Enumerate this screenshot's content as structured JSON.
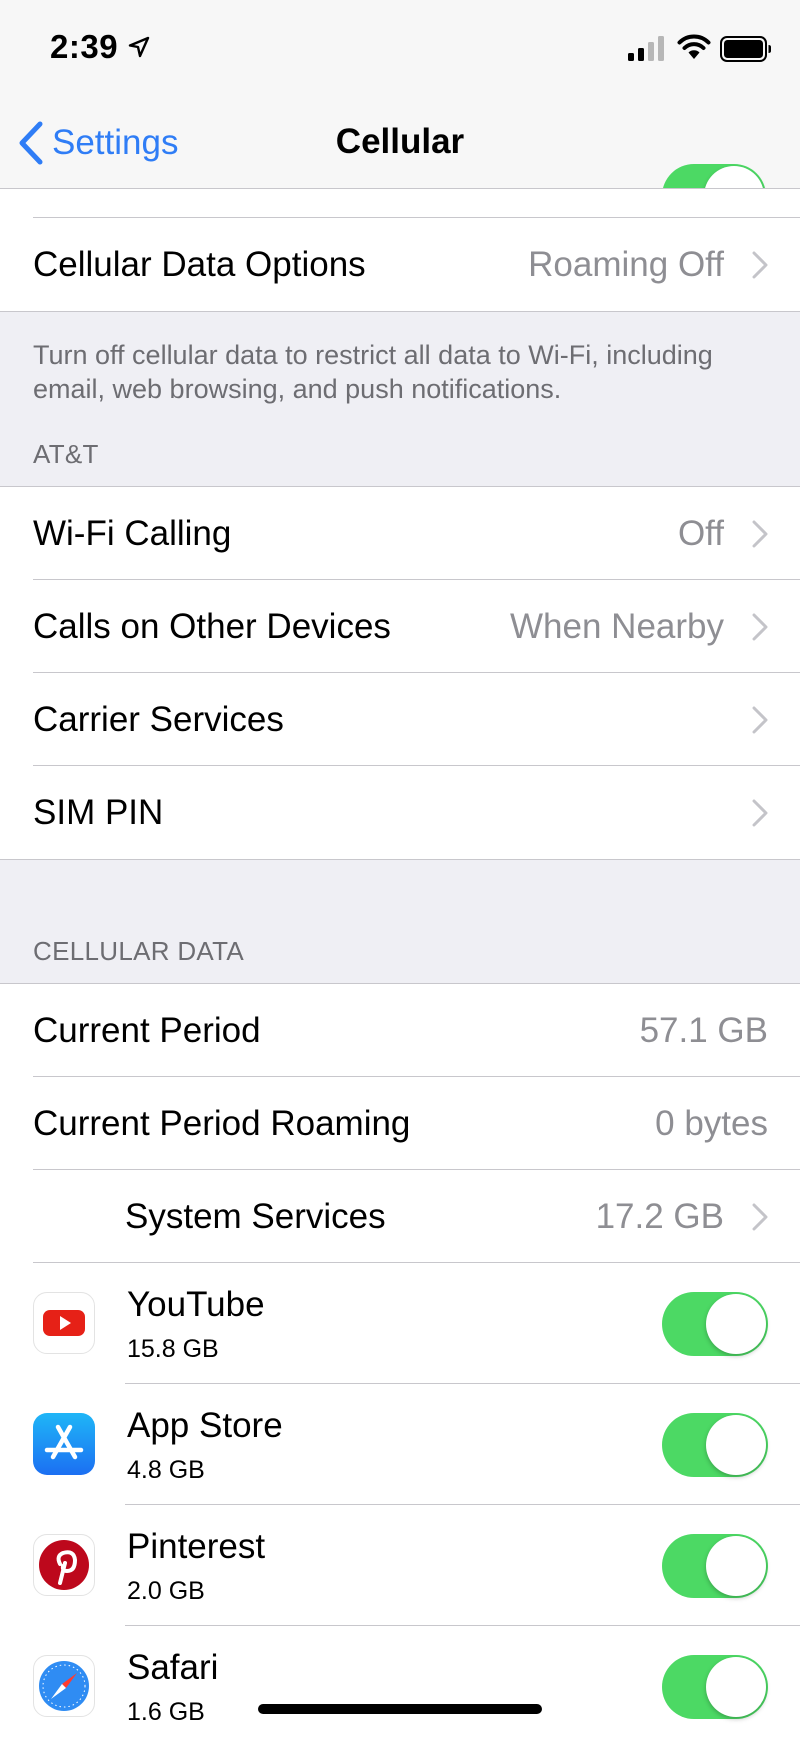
{
  "status_bar": {
    "time": "2:39"
  },
  "nav": {
    "back_label": "Settings",
    "title": "Cellular"
  },
  "top_group": {
    "cellular_data_options": {
      "label": "Cellular Data Options",
      "value": "Roaming Off"
    }
  },
  "cellular_note": "Turn off cellular data to restrict all data to Wi-Fi, including email, web browsing, and push notifications.",
  "carrier_section": {
    "header": "AT&T",
    "items": [
      {
        "label": "Wi-Fi Calling",
        "value": "Off"
      },
      {
        "label": "Calls on Other Devices",
        "value": "When Nearby"
      },
      {
        "label": "Carrier Services",
        "value": ""
      },
      {
        "label": "SIM PIN",
        "value": ""
      }
    ]
  },
  "data_section": {
    "header": "CELLULAR DATA",
    "current_period": {
      "label": "Current Period",
      "value": "57.1 GB"
    },
    "current_period_roaming": {
      "label": "Current Period Roaming",
      "value": "0 bytes"
    },
    "system_services": {
      "label": "System Services",
      "value": "17.2 GB"
    },
    "apps": [
      {
        "name": "YouTube",
        "usage": "15.8 GB",
        "enabled": true,
        "icon": "youtube-icon"
      },
      {
        "name": "App Store",
        "usage": "4.8 GB",
        "enabled": true,
        "icon": "app-store-icon"
      },
      {
        "name": "Pinterest",
        "usage": "2.0 GB",
        "enabled": true,
        "icon": "pinterest-icon"
      },
      {
        "name": "Safari",
        "usage": "1.6 GB",
        "enabled": true,
        "icon": "safari-icon"
      }
    ]
  },
  "colors": {
    "accent": "#2f7df6",
    "toggle_on": "#4cd964",
    "background": "#efeff4",
    "secondary_text": "#8e8e93"
  }
}
